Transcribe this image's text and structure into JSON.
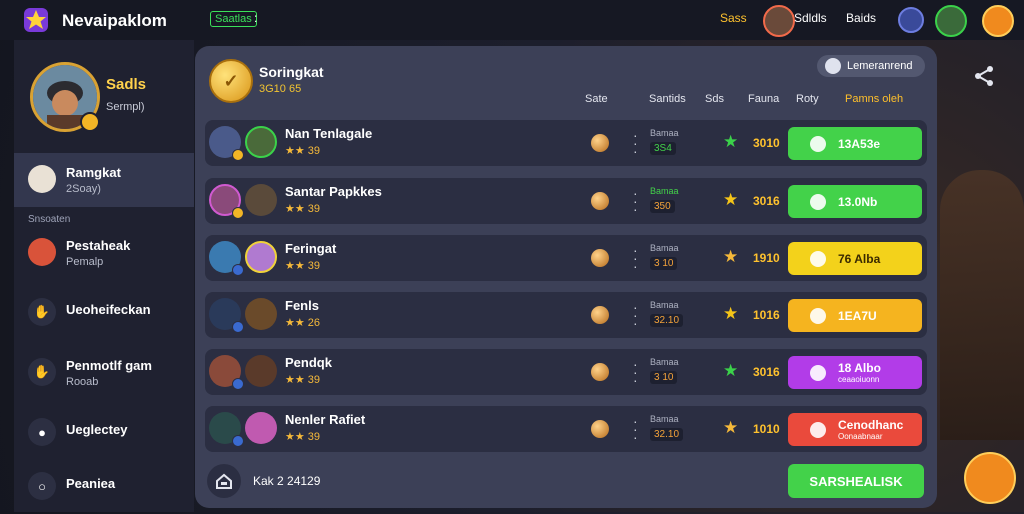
{
  "header": {
    "app_title": "Nevaipaklom",
    "badge": "Saatlas",
    "stats": [
      "Sass",
      "Sdldls",
      "Baids"
    ],
    "accent_color": "#3be05a"
  },
  "profile": {
    "name": "Sadls",
    "subtitle": "Sermpl)"
  },
  "sidebar": {
    "section_label": "Snsoaten",
    "items": [
      {
        "label": "Ramgkat",
        "sub": "2Soay)",
        "icon": "player-avatar-icon"
      },
      {
        "label": "Pestaheak",
        "sub": "Pemalp",
        "icon": "player-avatar-icon"
      },
      {
        "label": "Ueoheifeckan",
        "sub": "",
        "icon": "gesture-icon"
      },
      {
        "label": "Penmotlf gam",
        "sub": "Rooab",
        "icon": "gesture-icon"
      },
      {
        "label": "Ueglectey",
        "sub": "",
        "icon": "user-icon"
      },
      {
        "label": "Peaniea",
        "sub": "",
        "icon": "search-icon"
      }
    ]
  },
  "panel": {
    "title": "Soringkat",
    "subtitle": "3G10 65",
    "button_label": "Lemeranrend",
    "columns": [
      "Sate",
      "Santids",
      "Sds",
      "Fauna",
      "Roty",
      "Pamns oleh"
    ],
    "rows": [
      {
        "name": "Nan Tenlagale",
        "rating": "39",
        "small": "Bamaa",
        "tag": "3S4",
        "score": "3010",
        "action": "13A53e",
        "action_sub": "",
        "action_color": "#43d24a",
        "star_color": "#3bd24a",
        "tag_color": "#43d24a"
      },
      {
        "name": "Santar Papkkes",
        "rating": "39",
        "small": "Bamaa",
        "tag": "350",
        "score": "3016",
        "action": "13.0Nb",
        "action_sub": "",
        "action_color": "#43d24a",
        "star_color": "#f5c518",
        "tag_color": "#f3a23a"
      },
      {
        "name": "Feringat",
        "rating": "39",
        "small": "Bamaa",
        "tag": "3 10",
        "score": "1910",
        "action": "76 Alba",
        "action_sub": "",
        "action_color": "#f3d21b",
        "star_color": "#f5b93a",
        "tag_color": "#f3a23a"
      },
      {
        "name": "Fenls",
        "rating": "26",
        "small": "Bamaa",
        "tag": "32.10",
        "score": "1016",
        "action": "1EA7U",
        "action_sub": "",
        "action_color": "#f5b41f",
        "star_color": "#f5c518",
        "tag_color": "#f3a23a"
      },
      {
        "name": "Pendqk",
        "rating": "39",
        "small": "Bamaa",
        "tag": "3 10",
        "score": "3016",
        "action": "18 Albo",
        "action_sub": "ceaaoiuonn",
        "action_color": "#b23ce8",
        "star_color": "#3bd24a",
        "tag_color": "#f3a23a"
      },
      {
        "name": "Nenler Rafiet",
        "rating": "39",
        "small": "Bamaa",
        "tag": "32.10",
        "score": "1010",
        "action": "Cenodhanc",
        "action_sub": "Oonaabnaar",
        "action_color": "#ea4a3c",
        "star_color": "#f5b93a",
        "tag_color": "#f3a23a"
      }
    ]
  },
  "footer": {
    "label": "Kak 2 24129",
    "button": "SARSHEALISK"
  }
}
